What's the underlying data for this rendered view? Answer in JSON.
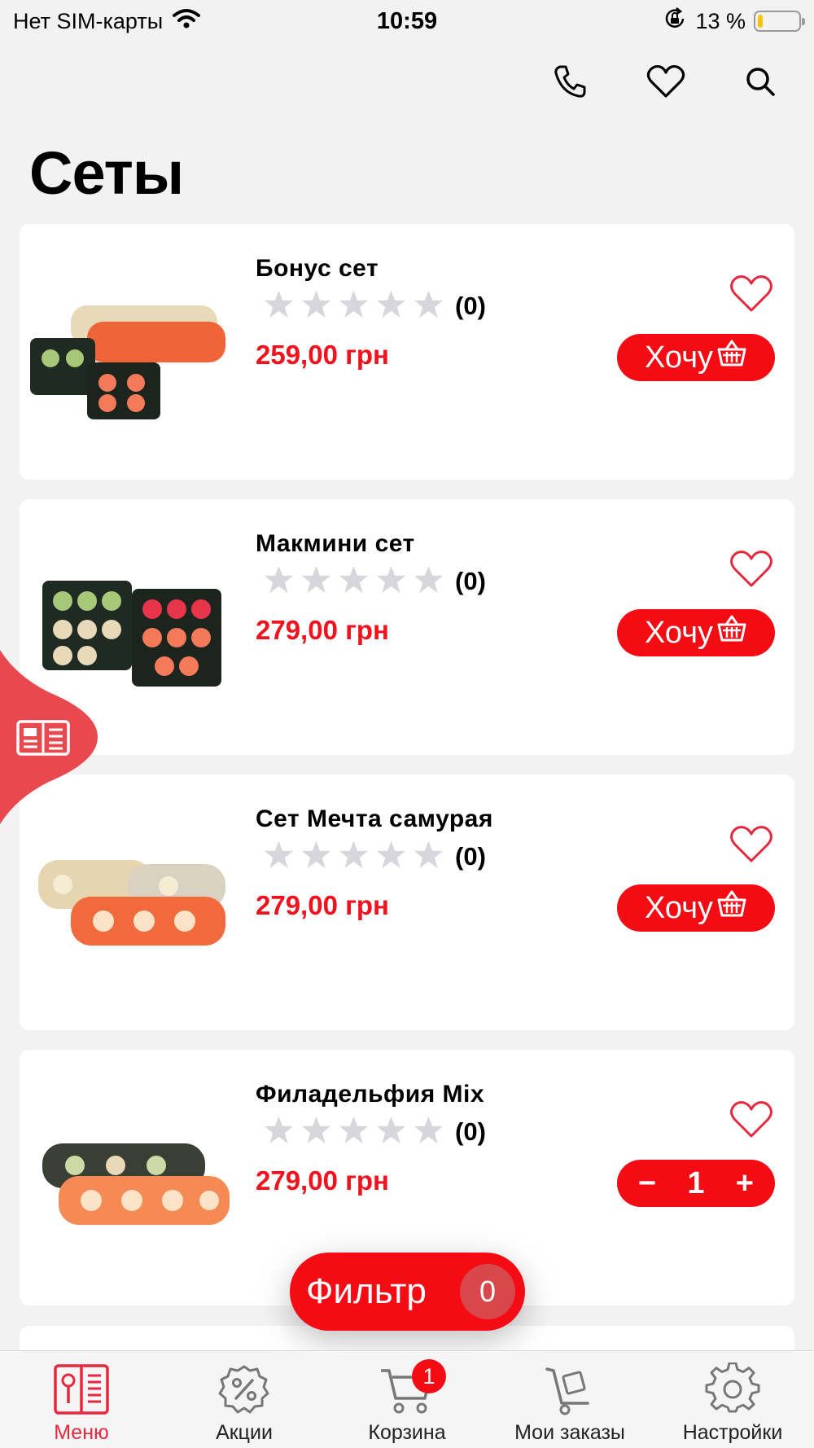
{
  "status_bar": {
    "carrier": "Нет SIM-карты",
    "time": "10:59",
    "battery_percent": "13 %",
    "battery_level": 0.13
  },
  "header": {
    "icons": [
      "phone-icon",
      "heart-icon",
      "search-icon"
    ]
  },
  "page": {
    "title": "Сеты"
  },
  "products": [
    {
      "name": "Бонус сет",
      "rating_count": "(0)",
      "rating": 0,
      "price": "259,00 грн",
      "action": "Хочу",
      "in_cart": false
    },
    {
      "name": "Макмини сет",
      "rating_count": "(0)",
      "rating": 0,
      "price": "279,00 грн",
      "action": "Хочу",
      "in_cart": false
    },
    {
      "name": "Сет Мечта самурая",
      "rating_count": "(0)",
      "rating": 0,
      "price": "279,00 грн",
      "action": "Хочу",
      "in_cart": false
    },
    {
      "name": "Филадельфия Mix",
      "rating_count": "(0)",
      "rating": 0,
      "price": "279,00 грн",
      "in_cart": true,
      "quantity": "1",
      "minus": "−",
      "plus": "+"
    }
  ],
  "filter": {
    "label": "Фильтр",
    "count": "0"
  },
  "tabs": [
    {
      "label": "Меню",
      "icon": "menu-book-icon",
      "active": true
    },
    {
      "label": "Акции",
      "icon": "discount-gear-icon"
    },
    {
      "label": "Корзина",
      "icon": "cart-icon",
      "badge": "1"
    },
    {
      "label": "Мои заказы",
      "icon": "delivery-cart-icon"
    },
    {
      "label": "Настройки",
      "icon": "settings-icon"
    }
  ],
  "colors": {
    "accent": "#f40b13",
    "price": "#f0121c",
    "heart": "#e5283e",
    "side_tab": "#e8494f",
    "background": "#f2f2f2"
  }
}
